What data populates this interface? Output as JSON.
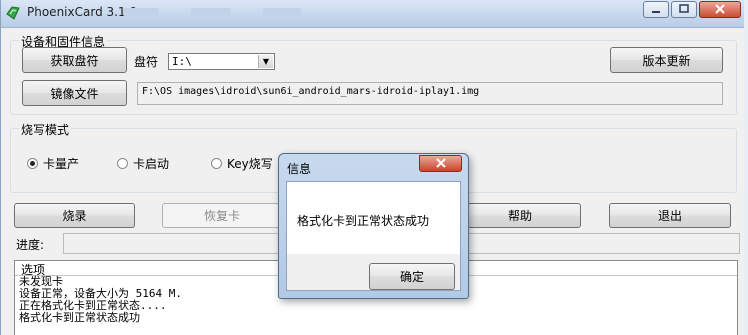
{
  "window": {
    "title": "PhoenixCard 3.1.0",
    "accent_color": "#c6d8ee"
  },
  "device_group": {
    "title": "设备和固件信息",
    "get_drive_button": "获取盘符",
    "drive_label": "盘符",
    "drive_value": "I:\\",
    "update_button": "版本更新",
    "image_button": "镜像文件",
    "image_path": "F:\\OS images\\idroid\\sun6i_android_mars-idroid-iplay1.img"
  },
  "burn_mode": {
    "title": "烧写模式",
    "options": [
      "卡量产",
      "卡启动",
      "Key烧写"
    ],
    "selected": "卡量产"
  },
  "actions": {
    "burn": "烧录",
    "restore": "恢复卡",
    "help": "帮助",
    "exit": "退出"
  },
  "progress": {
    "label": "进度:",
    "value": 0
  },
  "log": {
    "header": "选项",
    "lines": [
      "未发现卡",
      "设备正常，设备大小为 5164 M.",
      "正在格式化卡到正常状态....",
      "格式化卡到正常状态成功"
    ]
  },
  "dialog": {
    "title": "信息",
    "close": "x",
    "message": "格式化卡到正常状态成功",
    "ok_button": "确定"
  }
}
